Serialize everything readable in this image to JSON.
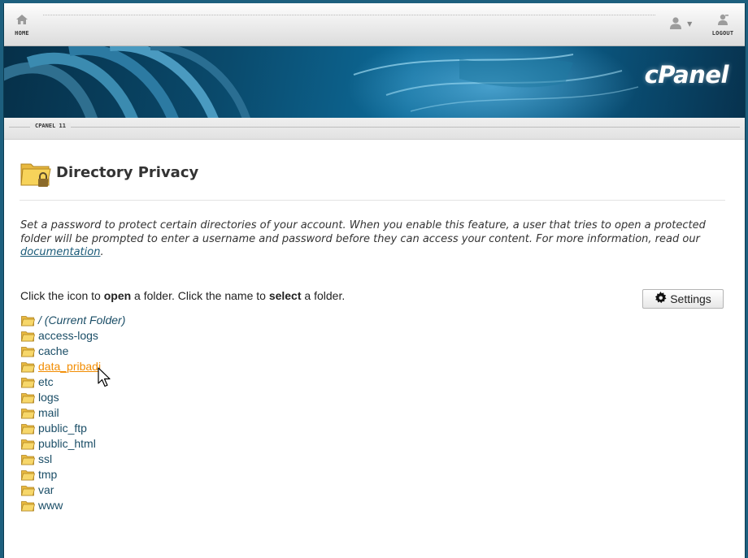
{
  "nav": {
    "home_label": "HOME",
    "logout_label": "LOGOUT",
    "home_icon": "house-icon",
    "user_icon": "user-icon",
    "logout_icon": "logout-user-icon"
  },
  "banner": {
    "brand": "cPanel",
    "version_label": "CPANEL 11",
    "color_dark": "#063049",
    "color_light": "#0d6a98"
  },
  "page": {
    "title": "Directory Privacy",
    "title_icon": "locked-folder-icon",
    "description": "Set a password to protect certain directories of your account. When you enable this feature, a user that tries to open a protected folder will be prompted to enter a username and password before they can access your content. For more information, read our",
    "doc_link": "documentation",
    "description_end": ".",
    "instructions": {
      "part1": "Click the icon to ",
      "bold1": "open",
      "part2": " a folder. Click the name to ",
      "bold2": "select",
      "part3": " a folder."
    },
    "settings_label": "Settings",
    "settings_icon": "gear-icon"
  },
  "folders": [
    {
      "name": "/ (Current Folder)",
      "current": true
    },
    {
      "name": "access-logs"
    },
    {
      "name": "cache"
    },
    {
      "name": "data_pribadi",
      "hovered": true
    },
    {
      "name": "etc"
    },
    {
      "name": "logs"
    },
    {
      "name": "mail"
    },
    {
      "name": "public_ftp"
    },
    {
      "name": "public_html"
    },
    {
      "name": "ssl"
    },
    {
      "name": "tmp"
    },
    {
      "name": "var"
    },
    {
      "name": "www"
    }
  ],
  "colors": {
    "link": "#1a4d66",
    "link_hover": "#f28c00",
    "folder_icon": "#f4cf5f"
  }
}
